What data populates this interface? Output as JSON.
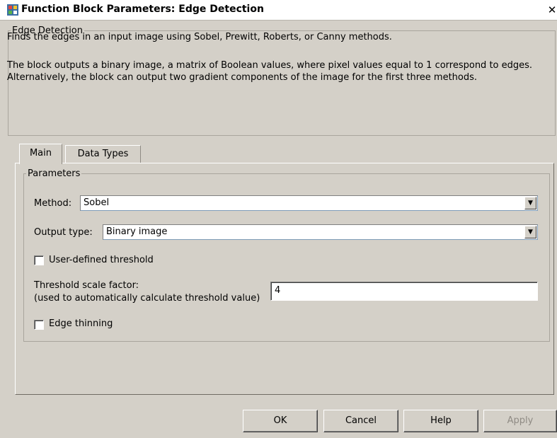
{
  "window": {
    "title": "Function Block Parameters: Edge Detection",
    "icon": "simulink-block-icon",
    "close_label": "✕"
  },
  "description": {
    "group_label": "Edge Detection",
    "line1": "Finds the edges in an input image using Sobel, Prewitt, Roberts, or Canny methods.",
    "line2": "The block outputs a binary image, a matrix of Boolean values, where pixel values equal to 1 correspond to edges.  Alternatively, the block can output two gradient components of the image for the first three methods."
  },
  "tabs": [
    {
      "label": "Main",
      "selected": true
    },
    {
      "label": "Data Types",
      "selected": false
    }
  ],
  "parameters": {
    "group_label": "Parameters",
    "method": {
      "label": "Method:",
      "value": "Sobel"
    },
    "output_type": {
      "label": "Output type:",
      "value": "Binary image"
    },
    "user_threshold": {
      "label": "User-defined threshold",
      "checked": false
    },
    "threshold_scale": {
      "label_line1": "Threshold scale factor:",
      "label_line2": "(used to automatically calculate threshold value)",
      "value": "4"
    },
    "edge_thinning": {
      "label": "Edge thinning",
      "checked": false
    }
  },
  "buttons": {
    "ok": "OK",
    "cancel": "Cancel",
    "help": "Help",
    "apply": "Apply"
  },
  "colors": {
    "dialog_bg": "#d4d0c8",
    "disabled_text": "#8f8b84"
  }
}
